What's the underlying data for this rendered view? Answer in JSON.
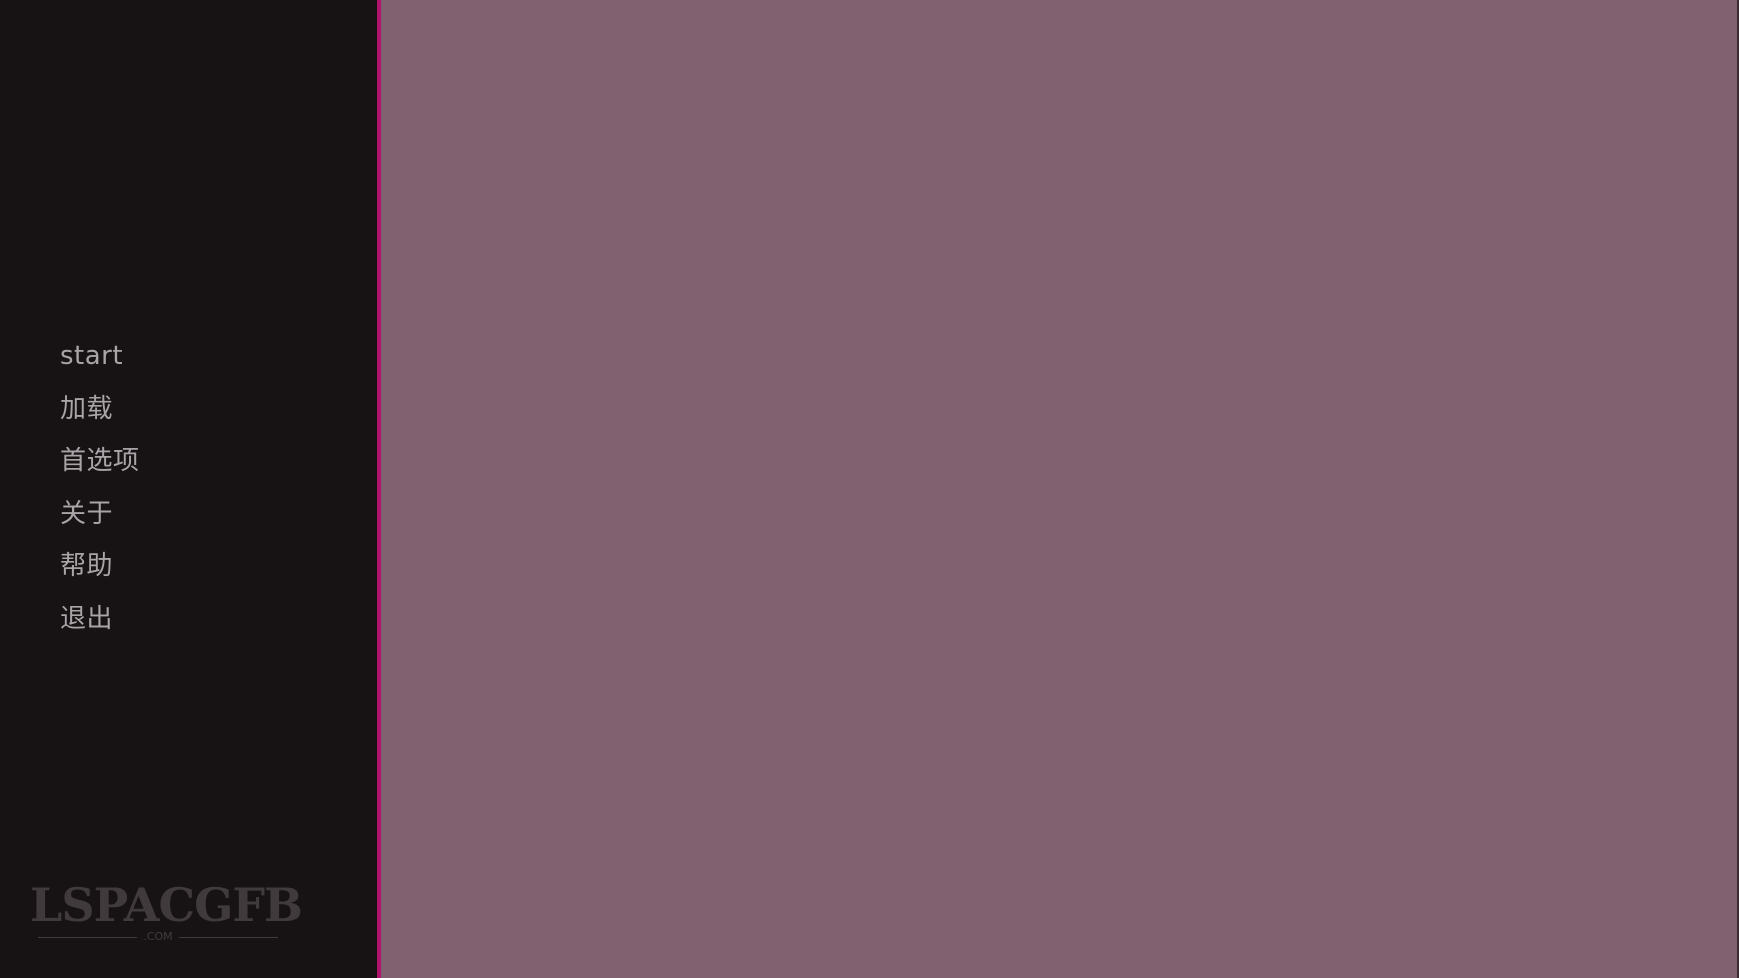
{
  "menu": {
    "items": [
      {
        "label": "start"
      },
      {
        "label": "加载"
      },
      {
        "label": "首选项"
      },
      {
        "label": "关于"
      },
      {
        "label": "帮助"
      },
      {
        "label": "退出"
      }
    ]
  },
  "watermark": {
    "text": "LSPACGFB",
    "subtext": ".COM"
  },
  "colors": {
    "sidebar": "#171315",
    "accent_divider": "#b0146e",
    "main_panel": "#81606f",
    "menu_text": "#a9a4a7"
  }
}
